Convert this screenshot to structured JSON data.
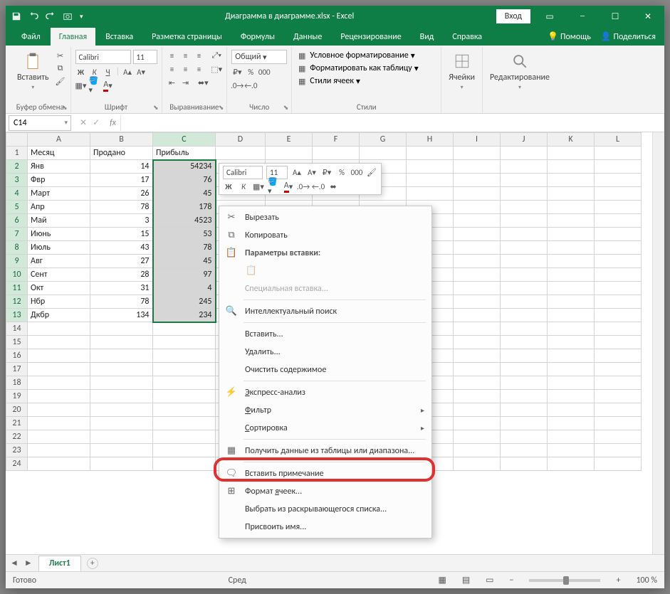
{
  "titlebar": {
    "signin": "Вход",
    "title_doc": "Диаграмма в диаграмме.xlsx",
    "title_app": "Excel"
  },
  "tabs": {
    "file": "Файл",
    "home": "Главная",
    "insert": "Вставка",
    "layout": "Разметка страницы",
    "formulas": "Формулы",
    "data": "Данные",
    "review": "Рецензирование",
    "view": "Вид",
    "help": "Справка",
    "tellme": "Помощь",
    "share": "Поделиться"
  },
  "ribbon": {
    "clipboard": {
      "label": "Буфер обмена",
      "paste": "Вставить"
    },
    "font": {
      "label": "Шрифт",
      "name": "Calibri",
      "size": "11",
      "bold": "Ж",
      "italic": "К",
      "underline": "Ч"
    },
    "align": {
      "label": "Выравнивание"
    },
    "number": {
      "label": "Число",
      "format": "Общий"
    },
    "styles": {
      "label": "Стили",
      "cond": "Условное форматирование",
      "table": "Форматировать как таблицу",
      "cell": "Стили ячеек"
    },
    "cells": {
      "label": "Ячейки",
      "btn": "Ячейки"
    },
    "editing": {
      "label": "",
      "btn": "Редактирование"
    }
  },
  "namebox": "C14",
  "columns": [
    "A",
    "B",
    "C",
    "D",
    "E",
    "F",
    "G",
    "H",
    "I",
    "J",
    "K",
    "L"
  ],
  "headers": {
    "a": "Месяц",
    "b": "Продано",
    "c": "Прибыль"
  },
  "rows": [
    {
      "a": "Янв",
      "b": "14",
      "c": "54234"
    },
    {
      "a": "Фвр",
      "b": "17",
      "c": "76"
    },
    {
      "a": "Март",
      "b": "26",
      "c": "45"
    },
    {
      "a": "Апр",
      "b": "78",
      "c": "178"
    },
    {
      "a": "Май",
      "b": "3",
      "c": "4523"
    },
    {
      "a": "Июнь",
      "b": "15",
      "c": "53"
    },
    {
      "a": "Июль",
      "b": "43",
      "c": "78"
    },
    {
      "a": "Авг",
      "b": "27",
      "c": "45"
    },
    {
      "a": "Сент",
      "b": "28",
      "c": "97"
    },
    {
      "a": "Окт",
      "b": "31",
      "c": "4"
    },
    {
      "a": "Нбр",
      "b": "78",
      "c": "245"
    },
    {
      "a": "Дкбр",
      "b": "134",
      "c": "234"
    }
  ],
  "mini": {
    "font": "Calibri",
    "size": "11",
    "bold": "Ж",
    "italic": "К"
  },
  "ctx": {
    "cut": "Вырезать",
    "copy": "Копировать",
    "paste_opts": "Параметры вставки:",
    "paste_special": "Специальная вставка...",
    "smart_lookup": "Интеллектуальный поиск",
    "insert": "Вставить...",
    "delete": "Удалить...",
    "clear": "Очистить содержимое",
    "quick": "Экспресс-анализ",
    "filter": "Фильтр",
    "sort": "Сортировка",
    "get_data": "Получить данные из таблицы или диапазона...",
    "comment": "Вставить примечание",
    "format": "Формат ячеек...",
    "dropdown": "Выбрать из раскрывающегося списка...",
    "name": "Присвоить имя..."
  },
  "sheet": {
    "tab": "Лист1"
  },
  "status": {
    "ready": "Готово",
    "avg": "Сред",
    "zoom": "100 %"
  }
}
